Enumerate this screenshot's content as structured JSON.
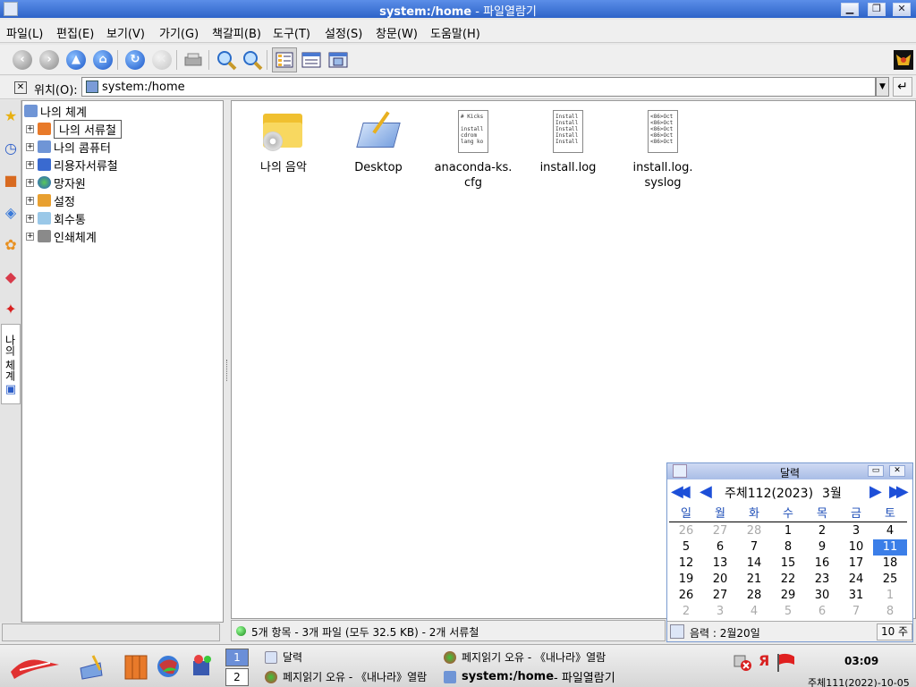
{
  "window": {
    "title_bold": "system:/home",
    "title_rest": " - 파일열람기",
    "min_label": "▁",
    "max_label": "❐",
    "close_label": "✕"
  },
  "menu": [
    "파일(L)",
    "편집(E)",
    "보기(V)",
    "가기(G)",
    "책갈피(B)",
    "도구(T)",
    "설정(S)",
    "창문(W)",
    "도움말(H)"
  ],
  "location": {
    "label": "위치(O):",
    "value": "system:/home",
    "drop_label": "▼",
    "go_label": "↵"
  },
  "sidebar": {
    "vertical_label": "나의 체계",
    "tabs": [
      "bookmark-star-icon",
      "history-clock-icon",
      "home-folder-icon",
      "network-icon",
      "services-icon",
      "media-icon",
      "pin-icon",
      "system-icon"
    ]
  },
  "tree": {
    "root": "나의 체계",
    "items": [
      {
        "label": "나의 서류철",
        "selected": true
      },
      {
        "label": "나의 콤퓨터"
      },
      {
        "label": "리용자서류철"
      },
      {
        "label": "망자원"
      },
      {
        "label": "설정"
      },
      {
        "label": "회수통"
      },
      {
        "label": "인쇄체계"
      }
    ]
  },
  "files": [
    {
      "label": "나의 음악",
      "kind": "music-folder"
    },
    {
      "label": "Desktop",
      "kind": "desktop-folder"
    },
    {
      "label": "anaconda-ks.\ncfg",
      "kind": "text",
      "preview": "# Kicks\n\ninstall\ncdrom\nlang ko"
    },
    {
      "label": "install.log",
      "kind": "text",
      "preview": "Install\nInstall\nInstall\nInstall\nInstall"
    },
    {
      "label": "install.log.\nsyslog",
      "kind": "text",
      "preview": "<86>Oct\n<86>Oct\n<86>Oct\n<86>Oct\n<86>Oct"
    }
  ],
  "status": {
    "text": "5개 항목 - 3개 파일 (모두 32.5 KB) - 2개 서류철"
  },
  "calendar": {
    "title": "달력",
    "year": "주체112(2023)",
    "month": "3월",
    "prev_year": "◀◀",
    "prev_month": "◀",
    "next_month": "▶",
    "next_year": "▶▶",
    "weekdays": [
      "일",
      "월",
      "화",
      "수",
      "목",
      "금",
      "토"
    ],
    "weeks": [
      [
        "26",
        "27",
        "28",
        "1",
        "2",
        "3",
        "4"
      ],
      [
        "5",
        "6",
        "7",
        "8",
        "9",
        "10",
        "11"
      ],
      [
        "12",
        "13",
        "14",
        "15",
        "16",
        "17",
        "18"
      ],
      [
        "19",
        "20",
        "21",
        "22",
        "23",
        "24",
        "25"
      ],
      [
        "26",
        "27",
        "28",
        "29",
        "30",
        "31",
        "1"
      ],
      [
        "2",
        "3",
        "4",
        "5",
        "6",
        "7",
        "8"
      ]
    ],
    "dim_first_row_count": 3,
    "dim_fifth_row_from": 6,
    "today": "11",
    "lunar": "음력 : 2월20일",
    "week_label": "10 주",
    "win_min": "▭",
    "win_close": "✕"
  },
  "taskbar": {
    "desktops": [
      "1",
      "2"
    ],
    "tasks": [
      {
        "label": "달력"
      },
      {
        "label": "페지읽기 오유 - 《내나라》열람"
      },
      {
        "label": "페지읽기 오유 - 《내나라》열람"
      },
      {
        "label": "system:/home",
        "rest": " - 파일열람기"
      }
    ],
    "tray_lang": "Я",
    "time": "03:09",
    "date": "주체111(2022)-10-05"
  },
  "colors": {
    "titlebar": "#2d63c8",
    "accent_blue": "#1d4fd8",
    "today_bg": "#3b7ee8",
    "calendar_header": "#1f4fb8"
  }
}
